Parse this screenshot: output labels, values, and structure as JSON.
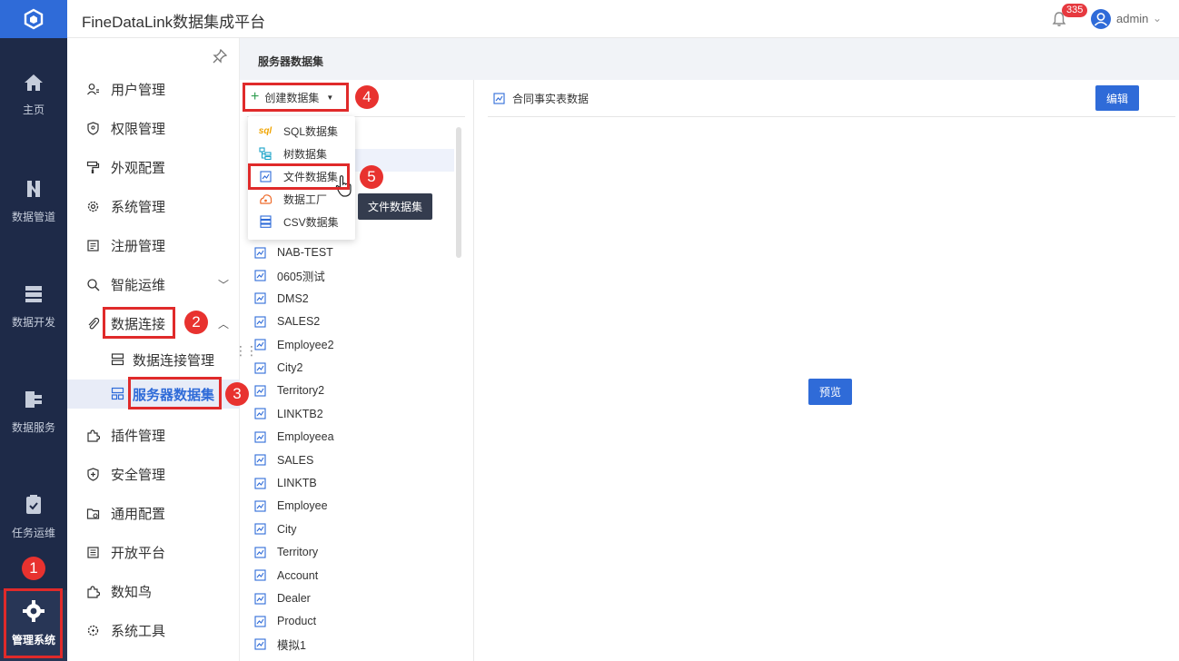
{
  "app": {
    "title": "FineDataLink数据集成平台"
  },
  "header": {
    "notification_count": "335",
    "user": "admin"
  },
  "leftnav": [
    {
      "label": "主页",
      "icon": "home-icon"
    },
    {
      "label": "数据管道",
      "icon": "pipeline-icon"
    },
    {
      "label": "数据开发",
      "icon": "dev-icon"
    },
    {
      "label": "数据服务",
      "icon": "service-icon"
    },
    {
      "label": "任务运维",
      "icon": "clipboard-icon"
    },
    {
      "label": "管理系统",
      "icon": "gear-icon",
      "active": true
    }
  ],
  "menu": {
    "items": [
      {
        "label": "用户管理"
      },
      {
        "label": "权限管理"
      },
      {
        "label": "外观配置"
      },
      {
        "label": "系统管理"
      },
      {
        "label": "注册管理"
      },
      {
        "label": "智能运维"
      },
      {
        "label": "数据连接"
      },
      {
        "label": "插件管理"
      },
      {
        "label": "安全管理"
      },
      {
        "label": "通用配置"
      },
      {
        "label": "开放平台"
      },
      {
        "label": "数知鸟"
      },
      {
        "label": "系统工具"
      }
    ],
    "sub": [
      {
        "label": "数据连接管理"
      },
      {
        "label": "服务器数据集",
        "selected": true
      }
    ]
  },
  "main": {
    "title": "服务器数据集"
  },
  "list": {
    "create_label": "创建数据集",
    "items": [
      "NAB-TEST",
      "0605测试",
      "DMS2",
      "SALES2",
      "Employee2",
      "City2",
      "Territory2",
      "LINKTB2",
      "Employeea",
      "SALES",
      "LINKTB",
      "Employee",
      "City",
      "Territory",
      "Account",
      "Dealer",
      "Product",
      "模拟1"
    ]
  },
  "dropdown": {
    "items": [
      {
        "label": "SQL数据集",
        "icon_text": "sql"
      },
      {
        "label": "树数据集"
      },
      {
        "label": "文件数据集"
      },
      {
        "label": "数据工厂"
      },
      {
        "label": "CSV数据集"
      }
    ],
    "tooltip": "文件数据集"
  },
  "detail": {
    "title": "合同事实表数据",
    "edit_label": "编辑",
    "preview_label": "预览"
  },
  "steps": [
    "1",
    "2",
    "3",
    "4",
    "5"
  ],
  "colors": {
    "accent": "#2f6bd8",
    "nav_bg": "#1e2a48",
    "annotation": "#e02a2a"
  }
}
